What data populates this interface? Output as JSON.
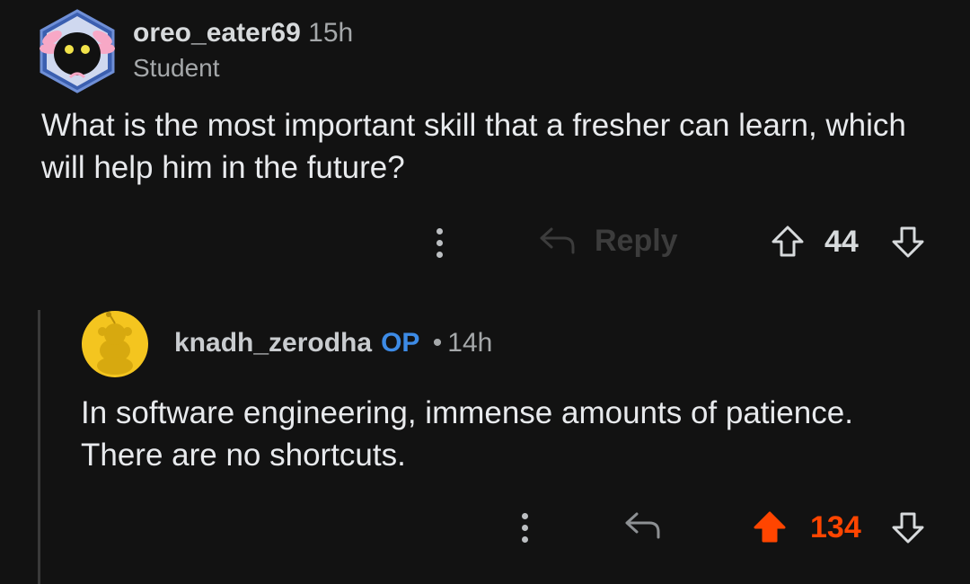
{
  "comments": [
    {
      "username": "oreo_eater69",
      "time": "15h",
      "flair": "Student",
      "body": "What is the most important skill that a fresher can learn, which will help him in the future?",
      "reply_label": "Reply",
      "score": "44",
      "upvoted": false
    },
    {
      "username": "knadh_zerodha",
      "op_badge": "OP",
      "separator": "•",
      "time": "14h",
      "body": "In software engineering, immense amounts of patience. There are no shortcuts.",
      "score": "134",
      "upvoted": true
    }
  ],
  "icons": [
    "axolotl-avatar-icon",
    "snoo-avatar-icon",
    "more-options-icon",
    "reply-icon",
    "upvote-icon",
    "downvote-icon"
  ],
  "colors": {
    "background": "#121212",
    "upvote_active": "#ff4500",
    "op_badge": "#3d8be6",
    "avatar2_bg": "#f4c51f"
  }
}
